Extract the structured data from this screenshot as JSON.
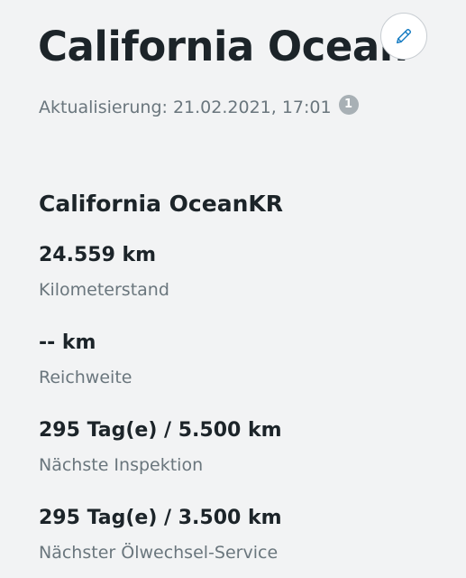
{
  "header": {
    "title": "California Ocean",
    "edit_icon": "pencil-icon",
    "updated": "Aktualisierung: 21.02.2021, 17:01",
    "info_badge": "1"
  },
  "vehicle": {
    "name": "California OceanKR"
  },
  "stats": [
    {
      "value": "24.559 km",
      "label": "Kilometerstand"
    },
    {
      "value": "-- km",
      "label": "Reichweite"
    },
    {
      "value": "295 Tag(e) / 5.500 km",
      "label": "Nächste Inspektion"
    },
    {
      "value": "295 Tag(e) / 3.500 km",
      "label": "Nächster Ölwechsel-Service"
    }
  ],
  "colors": {
    "background": "#f2f3f4",
    "text_primary": "#1c2429",
    "text_secondary": "#6a767d",
    "accent": "#1b7fc4",
    "badge": "#a8b0b5"
  }
}
